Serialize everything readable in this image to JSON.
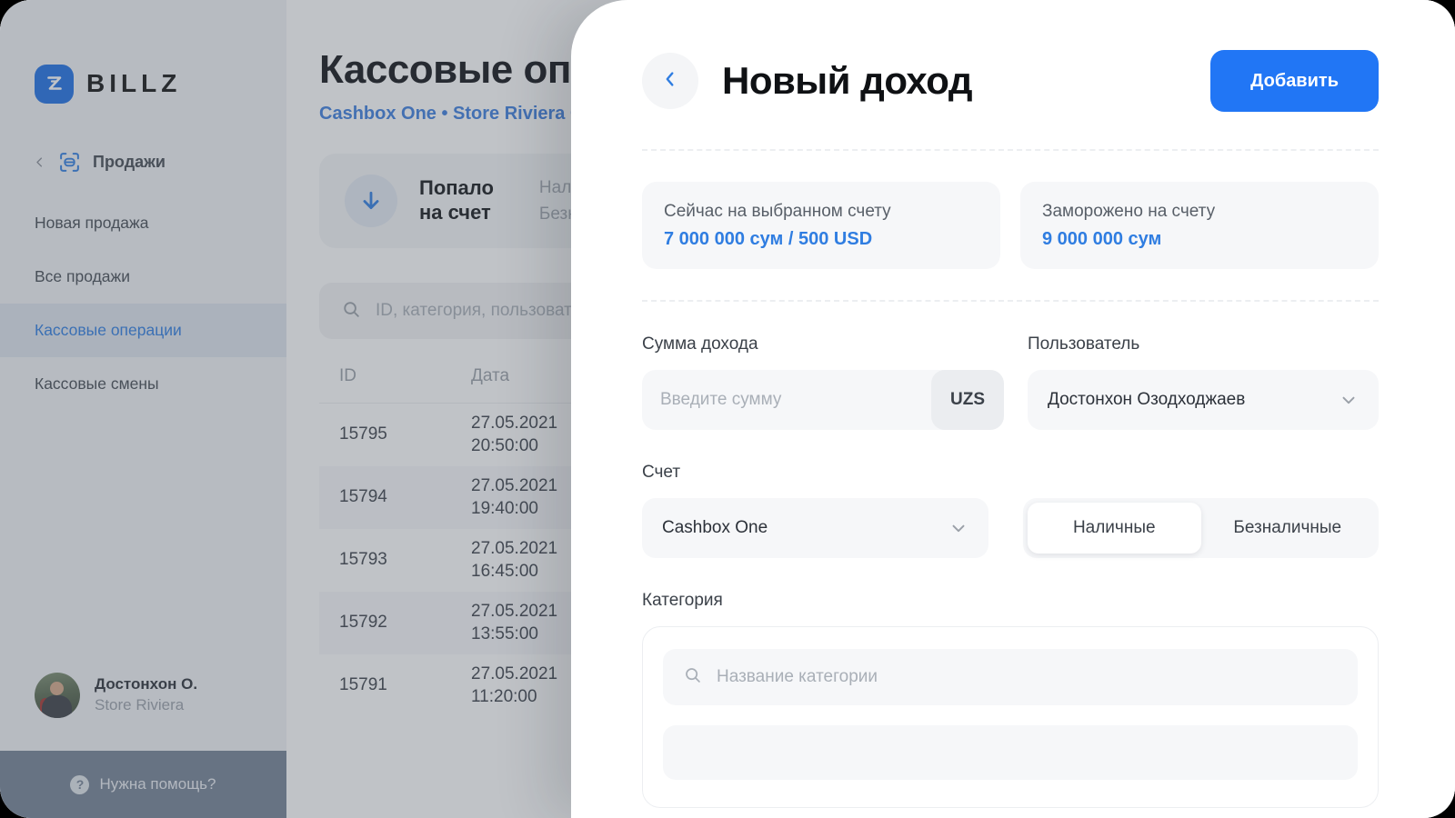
{
  "brand": {
    "mark_letter": "Z",
    "wordmark": "BILLZ",
    "accent": "#1f6fe5"
  },
  "sidebar": {
    "group": {
      "back_icon": "chevron-left-icon",
      "icon": "sales-scan-icon",
      "label": "Продажи"
    },
    "items": [
      {
        "label": "Новая продажа",
        "active": false
      },
      {
        "label": "Все продажи",
        "active": false
      },
      {
        "label": "Кассовые операции",
        "active": true
      },
      {
        "label": "Кассовые смены",
        "active": false
      }
    ],
    "user": {
      "name": "Достонхон О.",
      "store": "Store Riviera"
    },
    "help": {
      "icon": "question-mark-icon",
      "label": "Нужна помощь?"
    }
  },
  "main": {
    "title": "Кассовые операции",
    "subtitle": "Cashbox One • Store Riviera Cashbox",
    "stat_card": {
      "icon": "arrow-down-icon",
      "title": "Попало\nна счет",
      "title_line1": "Попало",
      "title_line2": "на счет",
      "rows": [
        "Наличные",
        "Безналичные"
      ]
    },
    "search": {
      "icon": "search-icon",
      "placeholder": "ID, категория, пользователь"
    },
    "table": {
      "columns": [
        "ID",
        "Дата"
      ],
      "rows": [
        {
          "id": "15795",
          "date": "27.05.2021",
          "time": "20:50:00"
        },
        {
          "id": "15794",
          "date": "27.05.2021",
          "time": "19:40:00"
        },
        {
          "id": "15793",
          "date": "27.05.2021",
          "time": "16:45:00"
        },
        {
          "id": "15792",
          "date": "27.05.2021",
          "time": "13:55:00"
        },
        {
          "id": "15791",
          "date": "27.05.2021",
          "time": "11:20:00"
        }
      ]
    }
  },
  "modal": {
    "back_icon": "chevron-left-icon",
    "title": "Новый доход",
    "submit_label": "Добавить",
    "submit_color": "#2176f5",
    "balances": [
      {
        "label": "Сейчас на выбранном счету",
        "value": "7 000 000 сум / 500 USD"
      },
      {
        "label": "Заморожено на счету",
        "value": "9 000 000 сум"
      }
    ],
    "amount": {
      "label": "Сумма дохода",
      "placeholder": "Введите сумму",
      "value": "",
      "currency": "UZS"
    },
    "user": {
      "label": "Пользователь",
      "value": "Достонхон Озодходжаев",
      "chevron_icon": "chevron-down-icon"
    },
    "account": {
      "label": "Счет",
      "value": "Cashbox One",
      "chevron_icon": "chevron-down-icon"
    },
    "payment_type": {
      "options": [
        "Наличные",
        "Безналичные"
      ],
      "selected": "Наличные"
    },
    "category": {
      "label": "Категория",
      "search_icon": "search-icon",
      "search_placeholder": "Название категории"
    }
  }
}
